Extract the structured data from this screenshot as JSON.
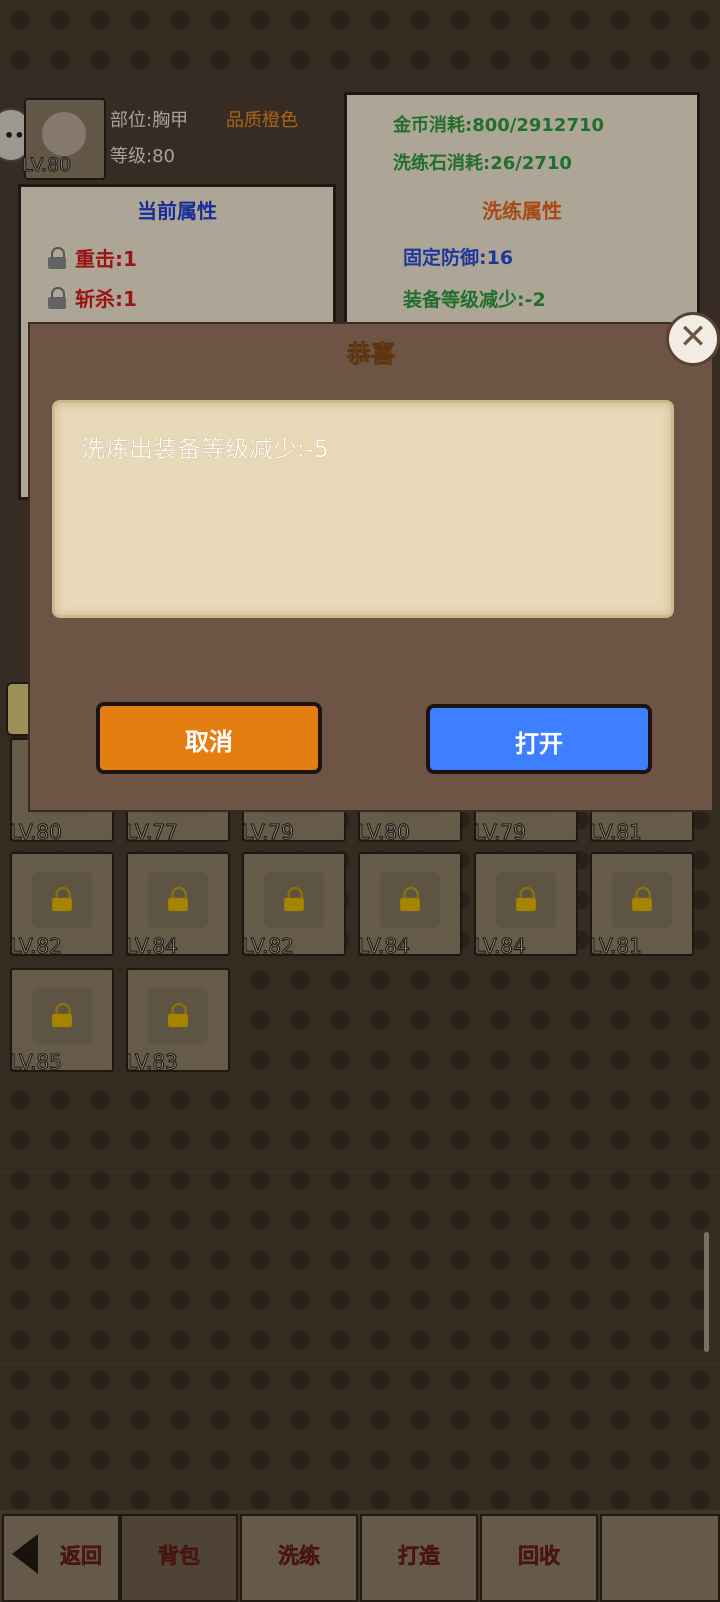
{
  "equipment": {
    "level_label": "LV.80",
    "slot_label": "部位:胸甲",
    "level_info": "等级:80",
    "quality_label": "品质橙色"
  },
  "current_attrs": {
    "title": "当前属性",
    "items": [
      "重击:1",
      "斩杀:1"
    ]
  },
  "refine": {
    "gold_cost": "金币消耗:800/2912710",
    "stone_cost": "洗练石消耗:26/2710",
    "title": "洗练属性",
    "attr_blue": "固定防御:16",
    "attr_green": "装备等级减少:-2"
  },
  "inventory": {
    "items": [
      {
        "level": "LV.80"
      },
      {
        "level": "LV.77"
      },
      {
        "level": "LV.79"
      },
      {
        "level": "LV.80"
      },
      {
        "level": "LV.79"
      },
      {
        "level": "LV.81"
      },
      {
        "level": "LV.82"
      },
      {
        "level": "LV.84"
      },
      {
        "level": "LV.82"
      },
      {
        "level": "LV.84"
      },
      {
        "level": "LV.84"
      },
      {
        "level": "LV.81"
      },
      {
        "level": "LV.85"
      },
      {
        "level": "LV.83"
      }
    ]
  },
  "modal": {
    "title": "恭喜",
    "message": "洗炼出装备等级减少:-5",
    "cancel_label": "取消",
    "open_label": "打开",
    "close_icon": "close-icon"
  },
  "bottom_nav": {
    "back": "返回",
    "bag": "背包",
    "refine": "洗练",
    "forge": "打造",
    "recycle": "回收"
  },
  "colors": {
    "accent_orange": "#e47e12",
    "accent_blue": "#3e7fff",
    "attr_red": "#d81b1b"
  }
}
